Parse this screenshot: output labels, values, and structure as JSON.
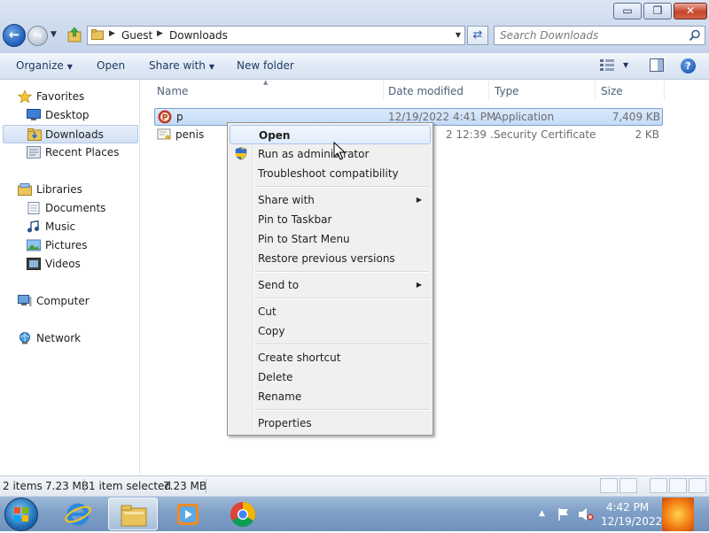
{
  "window": {
    "controls": {
      "minimize": "▭",
      "maximize": "❐",
      "close": "✕"
    }
  },
  "address_bar": {
    "breadcrumbs": [
      "Guest",
      "Downloads"
    ],
    "search_placeholder": "Search Downloads"
  },
  "command_bar": {
    "organize_label": "Organize",
    "open_label": "Open",
    "share_label": "Share with",
    "new_folder_label": "New folder"
  },
  "nav_pane": {
    "favorites": {
      "label": "Favorites",
      "items": [
        "Desktop",
        "Downloads",
        "Recent Places"
      ],
      "selected": "Downloads"
    },
    "libraries": {
      "label": "Libraries",
      "items": [
        "Documents",
        "Music",
        "Pictures",
        "Videos"
      ]
    },
    "computer": "Computer",
    "network": "Network"
  },
  "file_list": {
    "columns": [
      "Name",
      "Date modified",
      "Type",
      "Size"
    ],
    "rows": [
      {
        "name": "p",
        "date": "12/19/2022 4:41 PM",
        "type": "Application",
        "size": "7,409 KB",
        "selected": true
      },
      {
        "name": "penis",
        "date": "2 12:39 ...",
        "type": "Security Certificate",
        "size": "2 KB",
        "selected": false
      }
    ]
  },
  "context_menu": {
    "items": {
      "open": "Open",
      "run_as_admin": "Run as administrator",
      "troubleshoot": "Troubleshoot compatibility",
      "share_with": "Share with",
      "pin_taskbar": "Pin to Taskbar",
      "pin_start": "Pin to Start Menu",
      "restore": "Restore previous versions",
      "send_to": "Send to",
      "cut": "Cut",
      "copy": "Copy",
      "create_shortcut": "Create shortcut",
      "delete": "Delete",
      "rename": "Rename",
      "properties": "Properties"
    }
  },
  "status_bar": {
    "items_count": "2 items",
    "items_size": "7.23 MB",
    "selected_count": "1 item selected",
    "selected_size": "7.23 MB"
  },
  "taskbar": {
    "apps": [
      "internet-explorer",
      "windows-explorer",
      "media-player",
      "chrome"
    ],
    "active_app": "windows-explorer",
    "clock": {
      "time": "4:42 PM",
      "date": "12/19/2022"
    }
  },
  "colors": {
    "accent": "#1d5cb8",
    "selection": "#c4dbf7",
    "menu_bg": "#f0f0f0",
    "taskbar": "#7f9fc6"
  }
}
